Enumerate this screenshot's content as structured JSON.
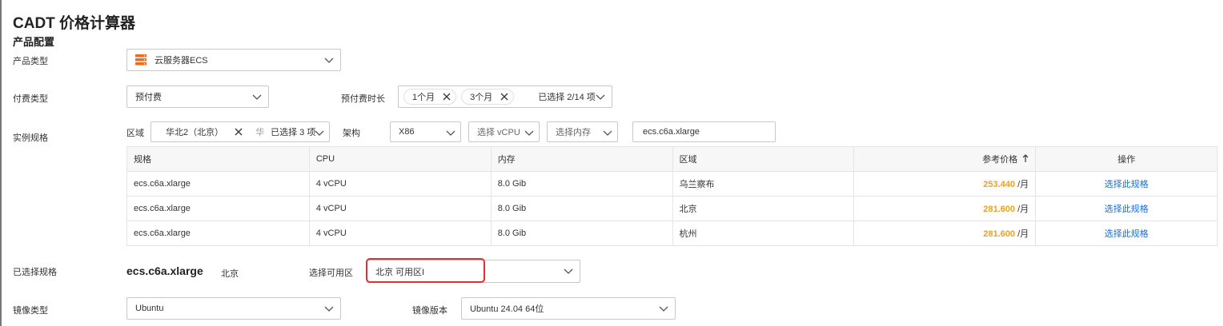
{
  "page": {
    "title": "CADT 价格计算器",
    "section": "产品配置"
  },
  "product_type": {
    "label": "产品类型",
    "value": "云服务器ECS",
    "icon": "ecs-server-icon"
  },
  "billing": {
    "label": "付费类型",
    "value": "预付费",
    "duration_label": "预付费时长",
    "duration_tags": [
      "1个月",
      "3个月"
    ],
    "duration_summary": "已选择 2/14 项"
  },
  "instance": {
    "label": "实例规格",
    "region_label": "区域",
    "region_tag": "华北2（北京）",
    "region_overflow": "华",
    "region_summary": "已选择 3 项",
    "arch_label": "架构",
    "arch_value": "X86",
    "vcpu_placeholder": "选择 vCPU",
    "memory_placeholder": "选择内存",
    "search_value": "ecs.c6a.xlarge"
  },
  "table": {
    "headers": {
      "spec": "规格",
      "cpu": "CPU",
      "memory": "内存",
      "region": "区域",
      "price": "参考价格",
      "action": "操作"
    },
    "sort_icon": "arrow-up-icon",
    "rows": [
      {
        "spec": "ecs.c6a.xlarge",
        "cpu": "4 vCPU",
        "memory": "8.0 Gib",
        "region": "乌兰察布",
        "price": "253.440",
        "unit": "/月",
        "action": "选择此规格"
      },
      {
        "spec": "ecs.c6a.xlarge",
        "cpu": "4 vCPU",
        "memory": "8.0 Gib",
        "region": "北京",
        "price": "281.600",
        "unit": "/月",
        "action": "选择此规格"
      },
      {
        "spec": "ecs.c6a.xlarge",
        "cpu": "4 vCPU",
        "memory": "8.0 Gib",
        "region": "杭州",
        "price": "281.600",
        "unit": "/月",
        "action": "选择此规格"
      }
    ]
  },
  "selected": {
    "label": "已选择规格",
    "spec": "ecs.c6a.xlarge",
    "region": "北京",
    "zone_label": "选择可用区",
    "zone_value": "北京 可用区I"
  },
  "image": {
    "type_label": "镜像类型",
    "type_value": "Ubuntu",
    "version_label": "镜像版本",
    "version_value": "Ubuntu 24.04 64位"
  },
  "colors": {
    "price": "#f0a020",
    "link": "#1a6fd9",
    "highlight": "#e03030",
    "ecs_icon": "#f06a1d"
  }
}
